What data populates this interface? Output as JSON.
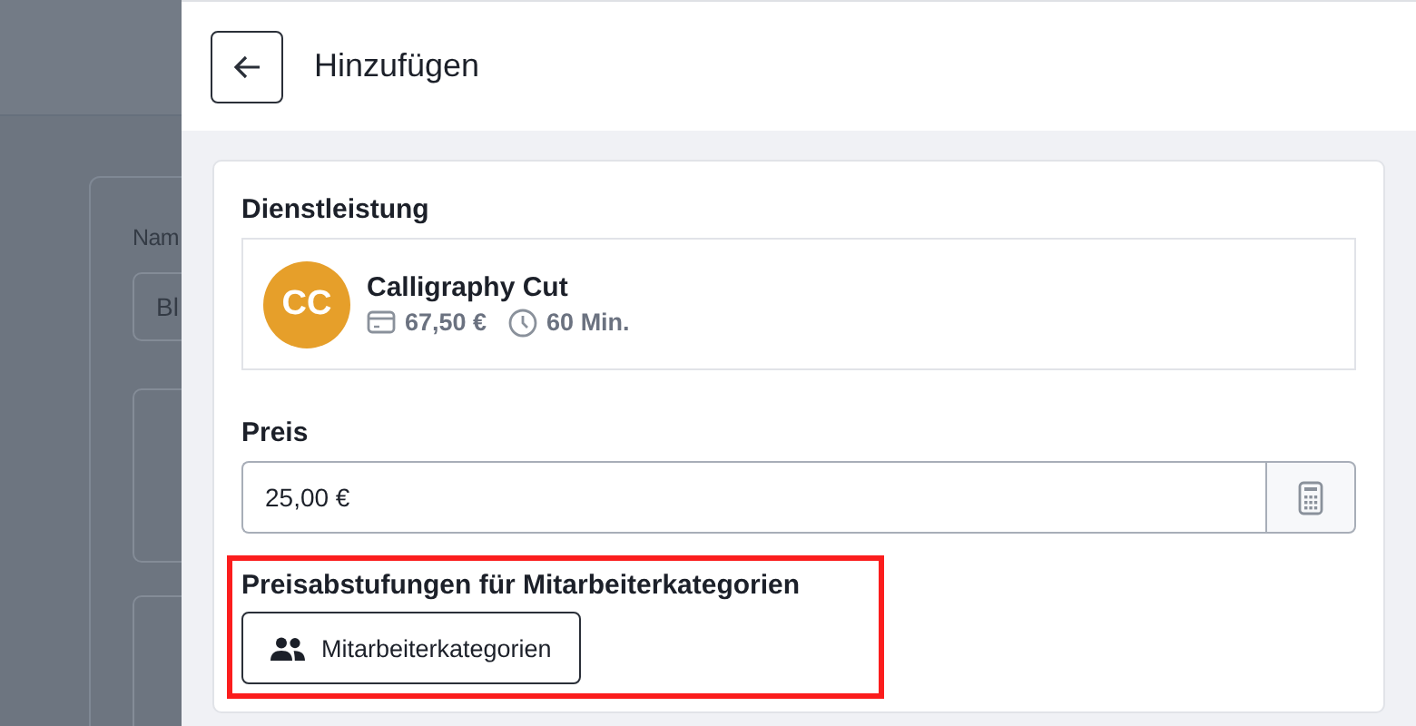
{
  "background": {
    "field_label": "Nam",
    "field_value": "Bl"
  },
  "panel": {
    "title": "Hinzufügen",
    "service_section": {
      "label": "Dienstleistung",
      "service": {
        "initials": "CC",
        "color": "#e69f2a",
        "name": "Calligraphy Cut",
        "price": "67,50 €",
        "duration": "60 Min."
      }
    },
    "price_field": {
      "label": "Preis",
      "value": "25,00 €"
    },
    "tiers_section": {
      "label": "Preisabstufungen für Mitarbeiterkategorien",
      "button": "Mitarbeiterkategorien",
      "highlighted": true
    }
  }
}
